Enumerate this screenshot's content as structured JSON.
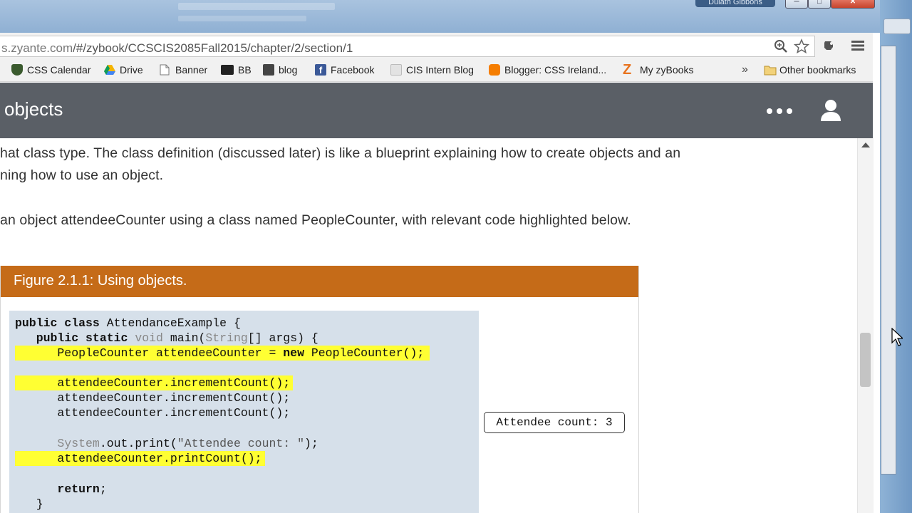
{
  "window": {
    "user_name": "Dulath Gibbons",
    "minimize_label": "─",
    "maximize_label": "□",
    "close_label": "✕"
  },
  "browser": {
    "url_host": "s.zyante.com",
    "url_path": "/#/zybook/CCSCIS2085Fall2015/chapter/2/section/1",
    "bookmarks": [
      {
        "label": "CSS Calendar",
        "icon": "shield-icon",
        "color": "#3a5a2e"
      },
      {
        "label": "Drive",
        "icon": "drive-icon",
        "color": "#f4b400"
      },
      {
        "label": "Banner",
        "icon": "page-icon",
        "color": "#ffffff"
      },
      {
        "label": "BB",
        "icon": "bb-icon",
        "color": "#222222"
      },
      {
        "label": "blog",
        "icon": "blog-icon",
        "color": "#444444"
      },
      {
        "label": "Facebook",
        "icon": "facebook-icon",
        "color": "#3b5998"
      },
      {
        "label": "CIS Intern Blog",
        "icon": "cis-icon",
        "color": "#d9d9d9"
      },
      {
        "label": "Blogger: CSS Ireland...",
        "icon": "blogger-icon",
        "color": "#f57d00"
      },
      {
        "label": "My zyBooks",
        "icon": "zybooks-icon",
        "color": "#e8731f"
      }
    ],
    "overflow_label": "»",
    "other_bookmarks_label": "Other bookmarks"
  },
  "app_header": {
    "title": "objects"
  },
  "content": {
    "para1_line1": "hat class type. The class definition (discussed later) is like a blueprint explaining how to create objects and an",
    "para1_line2": "ning how to use an object.",
    "para2": "an object attendeeCounter using a class named PeopleCounter, with relevant code highlighted below."
  },
  "figure": {
    "title": "Figure 2.1.1: Using objects.",
    "code_lines": [
      "public class AttendanceExample {",
      "   public static void main(String[] args) {",
      "      PeopleCounter attendeeCounter = new PeopleCounter();",
      "",
      "      attendeeCounter.incrementCount();",
      "      attendeeCounter.incrementCount();",
      "      attendeeCounter.incrementCount();",
      "",
      "      System.out.print(\"Attendee count: \");",
      "      attendeeCounter.printCount();",
      "",
      "      return;",
      "   }"
    ],
    "output": "Attendee count: 3"
  },
  "colors": {
    "figure_header": "#c56b18",
    "code_background": "#d6e0ea",
    "highlight": "#ffff33",
    "app_header": "#5a5f66"
  }
}
